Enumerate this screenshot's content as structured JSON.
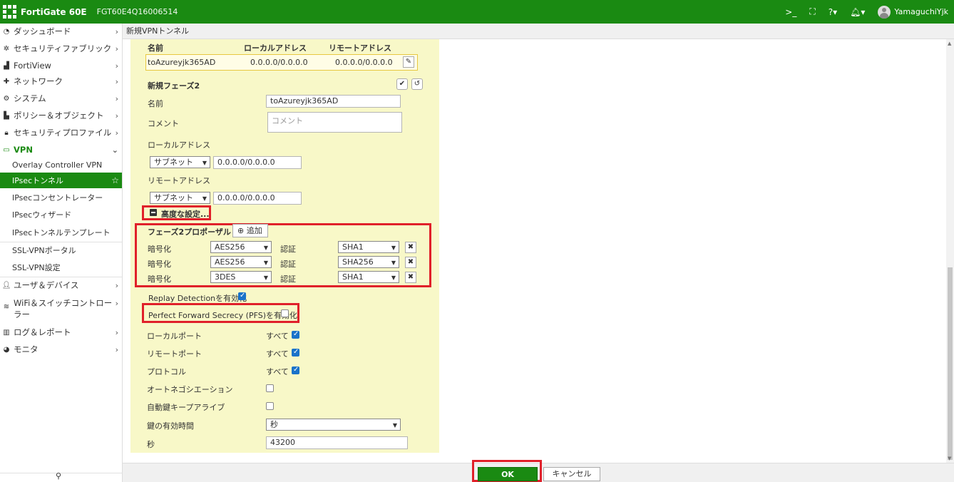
{
  "topbar": {
    "product": "FortiGate 60E",
    "serial": "FGT60E4Q16006514",
    "user": "YamaguchiYjk",
    "cli_icon": "cli-icon",
    "fullscreen_icon": "fullscreen-icon",
    "help_icon": "help-icon",
    "bell_icon": "bell-icon",
    "accent_color": "#1a8a12"
  },
  "sidebar": {
    "items": [
      {
        "label": "ダッシュボード",
        "icon": "dashboard-icon"
      },
      {
        "label": "セキュリティファブリック",
        "icon": "fabric-icon"
      },
      {
        "label": "FortiView",
        "icon": "fortiview-icon"
      },
      {
        "label": "ネットワーク",
        "icon": "network-icon"
      },
      {
        "label": "システム",
        "icon": "gear-icon"
      },
      {
        "label": "ポリシー＆オブジェクト",
        "icon": "policy-icon"
      },
      {
        "label": "セキュリティプロファイル",
        "icon": "lock-icon"
      },
      {
        "label": "VPN",
        "icon": "laptop-icon"
      }
    ],
    "vpn_sub": [
      "Overlay Controller VPN",
      "IPsecトンネル",
      "IPsecコンセントレーター",
      "IPsecウィザード",
      "IPsecトンネルテンプレート",
      "SSL-VPNポータル",
      "SSL-VPN設定"
    ],
    "items_after": [
      {
        "label": "ユーザ＆デバイス",
        "icon": "user-icon"
      },
      {
        "label": "WiFi＆スイッチコントロー",
        "label2": "ラー",
        "icon": "wifi-icon"
      },
      {
        "label": "ログ＆レポート",
        "icon": "chart-icon"
      },
      {
        "label": "モニタ",
        "icon": "monitor-icon"
      }
    ]
  },
  "breadcrumb": "新規VPNトンネル",
  "tunnel_table": {
    "headers": [
      "名前",
      "ローカルアドレス",
      "リモートアドレス"
    ],
    "row": [
      "toAzureyjk365AD",
      "0.0.0.0/0.0.0.0",
      "0.0.0.0/0.0.0.0"
    ]
  },
  "phase2": {
    "title": "新規フェーズ2",
    "name_label": "名前",
    "name_value": "toAzureyjk365AD",
    "comment_label": "コメント",
    "comment_placeholder": "コメント",
    "local_address_label": "ローカルアドレス",
    "local_type": "サブネット",
    "local_value": "0.0.0.0/0.0.0.0",
    "remote_address_label": "リモートアドレス",
    "remote_type": "サブネット",
    "remote_value": "0.0.0.0/0.0.0.0",
    "advanced_label": "高度な設定..."
  },
  "proposal": {
    "title": "フェーズ2プロポーザル",
    "add_label": "追加",
    "encryption_label": "暗号化",
    "auth_label": "認証",
    "rows": [
      {
        "enc": "AES256",
        "auth": "SHA1"
      },
      {
        "enc": "AES256",
        "auth": "SHA256"
      },
      {
        "enc": "3DES",
        "auth": "SHA1"
      }
    ]
  },
  "options": {
    "replay": {
      "label": "Replay Detectionを有効化",
      "checked": true
    },
    "pfs": {
      "label": "Perfect Forward Secrecy (PFS)を有効化",
      "checked": false
    },
    "local_port": {
      "label": "ローカルポート",
      "value": "すべて",
      "checked": true
    },
    "remote_port": {
      "label": "リモートポート",
      "value": "すべて",
      "checked": true
    },
    "protocol": {
      "label": "プロトコル",
      "value": "すべて",
      "checked": true
    },
    "autoneg": {
      "label": "オートネゴシエーション",
      "checked": false
    },
    "autokey": {
      "label": "自動鍵キープアライブ",
      "checked": false
    },
    "key_lifetime": {
      "label": "鍵の有効時間",
      "value": "秒"
    },
    "seconds": {
      "label": "秒",
      "value": "43200"
    }
  },
  "footer": {
    "ok": "OK",
    "cancel": "キャンセル"
  }
}
